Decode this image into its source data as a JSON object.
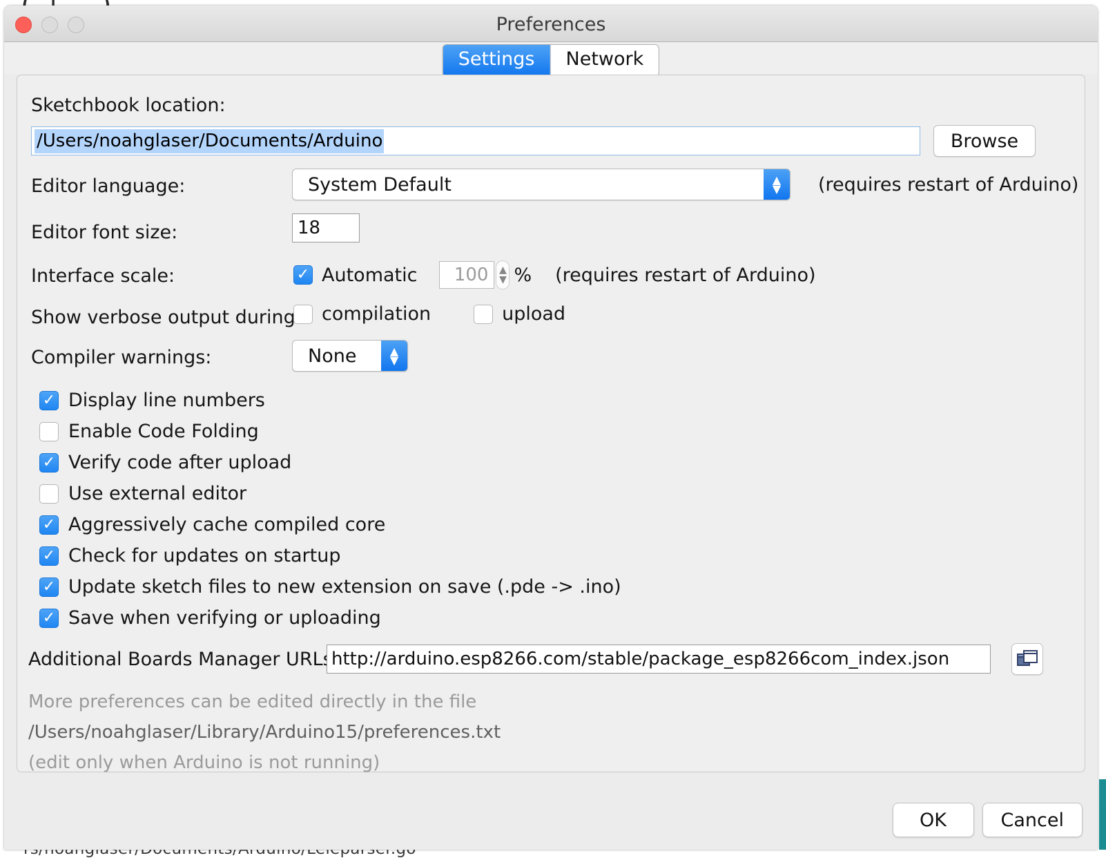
{
  "window": {
    "title": "Preferences",
    "traffic_lights": [
      "close-button",
      "minimize-button",
      "maximize-button"
    ],
    "accent_blue": "#1176ef",
    "selection_blue": "#b3d4fb"
  },
  "tabs": [
    {
      "label": "Settings",
      "active": true
    },
    {
      "label": "Network",
      "active": false
    }
  ],
  "settings": {
    "sketchbook": {
      "label": "Sketchbook location:",
      "value": "/Users/noahglaser/Documents/Arduino",
      "selected": true,
      "browse_label": "Browse"
    },
    "editor_language": {
      "label": "Editor language:",
      "value": "System Default",
      "note": "(requires restart of Arduino)"
    },
    "editor_font_size": {
      "label": "Editor font size:",
      "value": "18"
    },
    "interface_scale": {
      "label": "Interface scale:",
      "automatic_label": "Automatic",
      "automatic_checked": true,
      "value": "100",
      "percent": "%",
      "note": "(requires restart of Arduino)"
    },
    "verbose_output": {
      "label": "Show verbose output during:",
      "options": [
        {
          "label": "compilation",
          "checked": false
        },
        {
          "label": "upload",
          "checked": false
        }
      ]
    },
    "compiler_warnings": {
      "label": "Compiler warnings:",
      "value": "None"
    },
    "checkboxes": [
      {
        "label": "Display line numbers",
        "checked": true
      },
      {
        "label": "Enable Code Folding",
        "checked": false
      },
      {
        "label": "Verify code after upload",
        "checked": true
      },
      {
        "label": "Use external editor",
        "checked": false
      },
      {
        "label": "Aggressively cache compiled core",
        "checked": true
      },
      {
        "label": "Check for updates on startup",
        "checked": true
      },
      {
        "label": "Update sketch files to new extension on save (.pde -> .ino)",
        "checked": true
      },
      {
        "label": "Save when verifying or uploading",
        "checked": true
      }
    ],
    "boards_manager": {
      "label": "Additional Boards Manager URLs:",
      "value": "http://arduino.esp8266.com/stable/package_esp8266com_index.json"
    },
    "footer_note": {
      "line1": "More preferences can be edited directly in the file",
      "line2": "/Users/noahglaser/Library/Arduino15/preferences.txt",
      "line3": "(edit only when Arduino is not running)"
    }
  },
  "buttons": {
    "ok": "OK",
    "cancel": "Cancel"
  },
  "background": {
    "top_glyph": "(      |      .       )",
    "bottom_text": "rs/noahglaser/Documents/Arduino/Leleparser.go"
  }
}
